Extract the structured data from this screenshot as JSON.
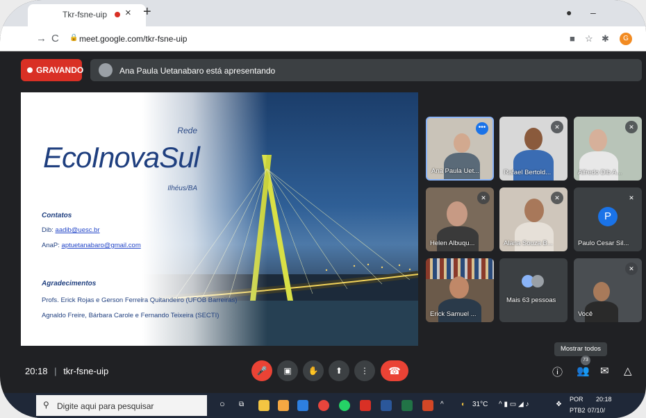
{
  "browser": {
    "tab_title": "Tkr-fsne-uip",
    "url": "meet.google.com/tkr-fsne-uip",
    "profile_initial": "G"
  },
  "meet": {
    "recording_label": "GRAVANDO",
    "presenting_text": "Ana Paula Uetanabaro está apresentando",
    "meeting_time": "20:18",
    "meeting_code": "tkr-fsne-uip",
    "tooltip": "Mostrar todos",
    "participant_count": "73"
  },
  "slide": {
    "rede": "Rede",
    "title": "EcoInovaSul",
    "city": "Ilhéus/BA",
    "contatos_heading": "Contatos",
    "dib_label": "Dib:",
    "dib_email": "aadib@uesc.br",
    "anap_label": "AnaP:",
    "anap_email": "aptuetanabaro@gmail.com",
    "agradecimentos_heading": "Agradecimentos",
    "line1": "Profs. Erick Rojas  e Gerson Ferreira Quitandeiro (UFOB Barreiras)",
    "line2": "Agnaldo Freire, Bárbara Carole e Fernando Teixeira (SECTI)"
  },
  "participants": [
    {
      "name": "Ana Paula Uet..."
    },
    {
      "name": "Rafael Bertold..."
    },
    {
      "name": "Alfredo Dib A..."
    },
    {
      "name": "Helen Albuqu..."
    },
    {
      "name": "Alana Souza B..."
    },
    {
      "name": "Paulo Cesar Sil...",
      "initial": "P"
    },
    {
      "name": "Erick Samuel ..."
    },
    {
      "name": "Mais 63 pessoas"
    },
    {
      "name": "Você"
    }
  ],
  "taskbar": {
    "search_placeholder": "Digite aqui para pesquisar",
    "temperature": "31°C",
    "lang1": "POR",
    "lang2": "PTB2",
    "time": "20:18",
    "date": "07/10/"
  },
  "colors": {
    "record_red": "#d93025",
    "meet_bg": "#202124",
    "tile_bg": "#3c4043",
    "accent_blue": "#1a73e8",
    "hangup_red": "#ea4335"
  }
}
